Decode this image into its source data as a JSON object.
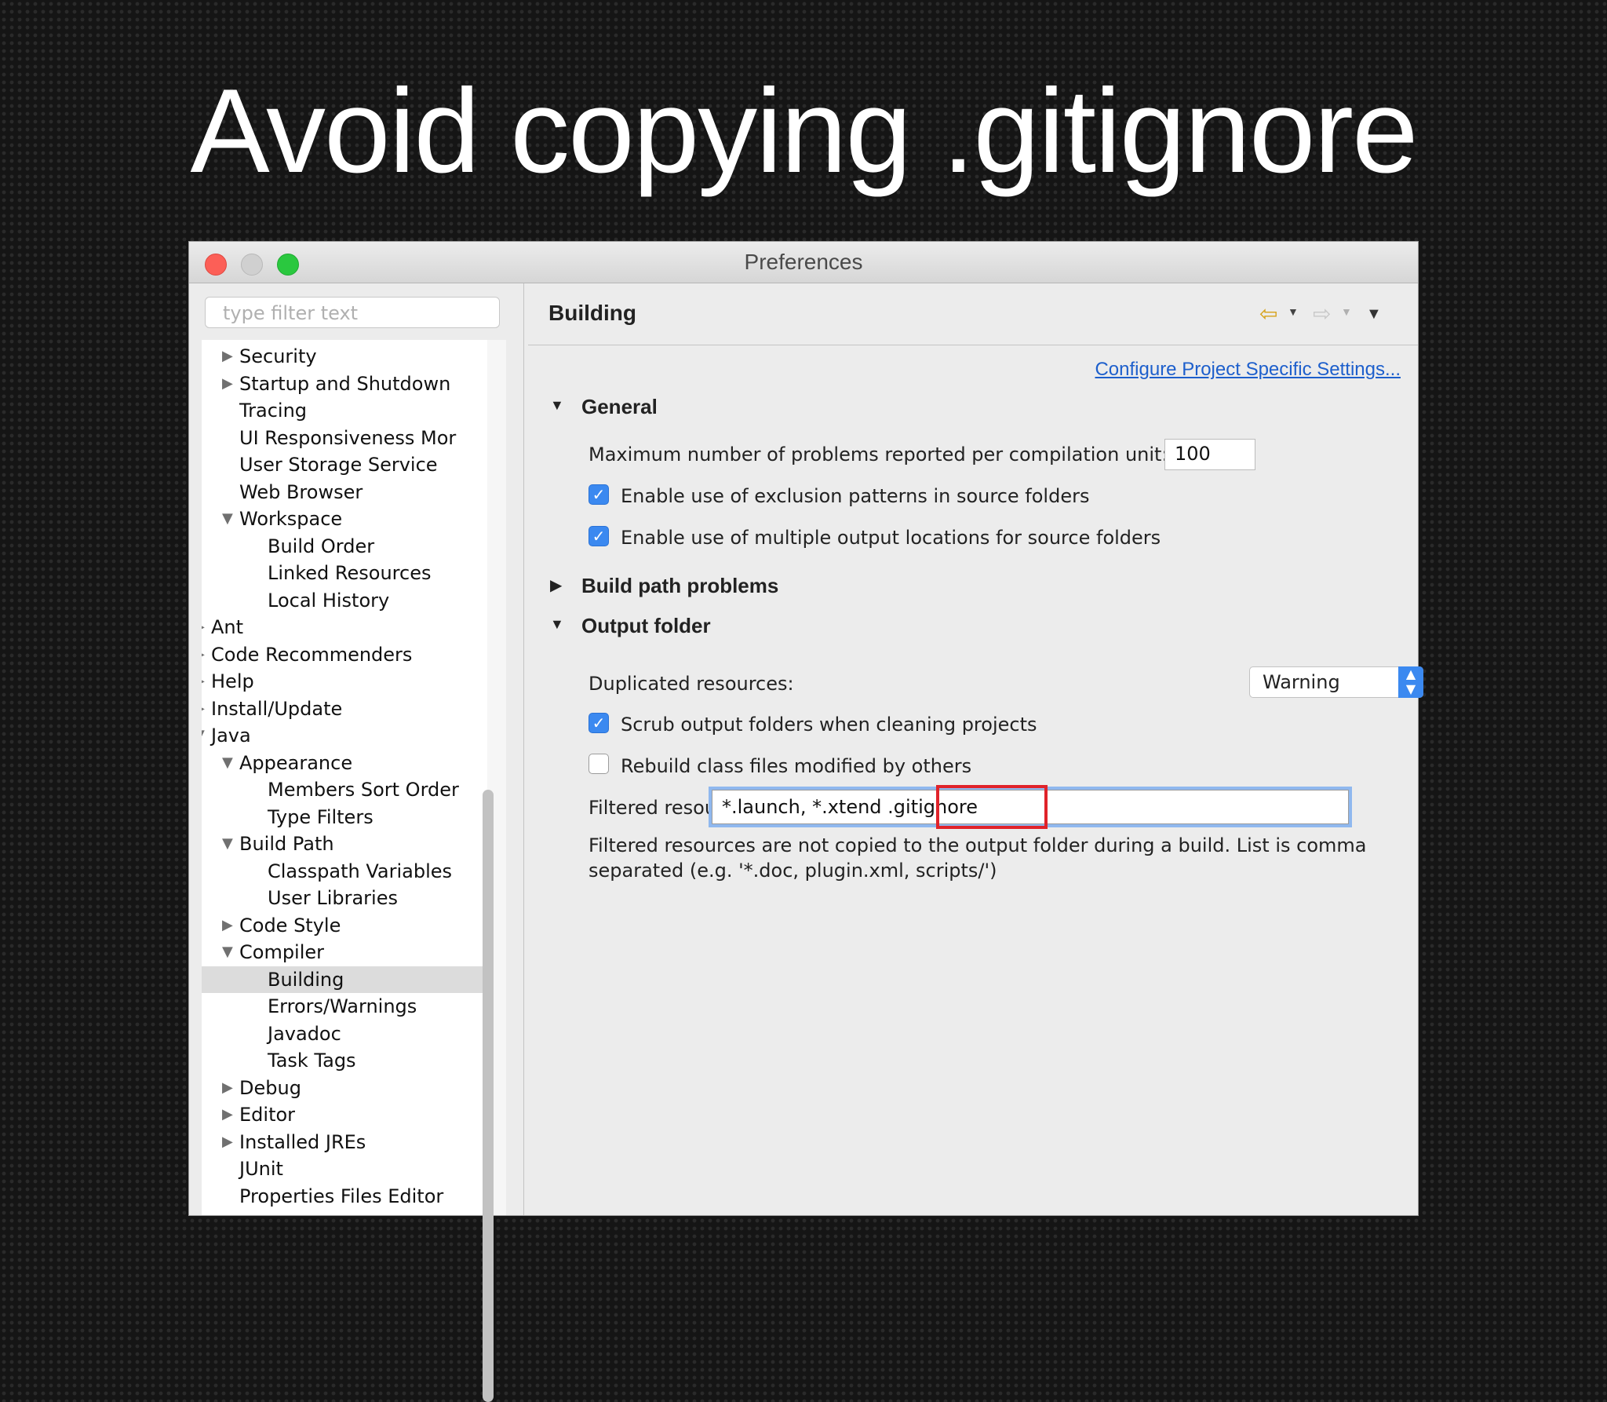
{
  "slide": {
    "title": "Avoid copying .gitignore"
  },
  "window": {
    "title": "Preferences"
  },
  "filter": {
    "placeholder": "type filter text"
  },
  "tree": [
    {
      "label": "Security",
      "level": 1,
      "toggle": "collapsed"
    },
    {
      "label": "Startup and Shutdown",
      "level": 1,
      "toggle": "collapsed"
    },
    {
      "label": "Tracing",
      "level": 1,
      "toggle": "none"
    },
    {
      "label": "UI Responsiveness Mor",
      "level": 1,
      "toggle": "none"
    },
    {
      "label": "User Storage Service",
      "level": 1,
      "toggle": "none"
    },
    {
      "label": "Web Browser",
      "level": 1,
      "toggle": "none"
    },
    {
      "label": "Workspace",
      "level": 1,
      "toggle": "expanded"
    },
    {
      "label": "Build Order",
      "level": 2,
      "toggle": "none"
    },
    {
      "label": "Linked Resources",
      "level": 2,
      "toggle": "none"
    },
    {
      "label": "Local History",
      "level": 2,
      "toggle": "none"
    },
    {
      "label": "Ant",
      "level": 0,
      "toggle": "collapsed"
    },
    {
      "label": "Code Recommenders",
      "level": 0,
      "toggle": "collapsed"
    },
    {
      "label": "Help",
      "level": 0,
      "toggle": "collapsed"
    },
    {
      "label": "Install/Update",
      "level": 0,
      "toggle": "collapsed"
    },
    {
      "label": "Java",
      "level": 0,
      "toggle": "expanded"
    },
    {
      "label": "Appearance",
      "level": 1,
      "toggle": "expanded"
    },
    {
      "label": "Members Sort Order",
      "level": 2,
      "toggle": "none"
    },
    {
      "label": "Type Filters",
      "level": 2,
      "toggle": "none"
    },
    {
      "label": "Build Path",
      "level": 1,
      "toggle": "expanded"
    },
    {
      "label": "Classpath Variables",
      "level": 2,
      "toggle": "none"
    },
    {
      "label": "User Libraries",
      "level": 2,
      "toggle": "none"
    },
    {
      "label": "Code Style",
      "level": 1,
      "toggle": "collapsed"
    },
    {
      "label": "Compiler",
      "level": 1,
      "toggle": "expanded"
    },
    {
      "label": "Building",
      "level": 2,
      "toggle": "none",
      "selected": true
    },
    {
      "label": "Errors/Warnings",
      "level": 2,
      "toggle": "none"
    },
    {
      "label": "Javadoc",
      "level": 2,
      "toggle": "none"
    },
    {
      "label": "Task Tags",
      "level": 2,
      "toggle": "none"
    },
    {
      "label": "Debug",
      "level": 1,
      "toggle": "collapsed"
    },
    {
      "label": "Editor",
      "level": 1,
      "toggle": "collapsed"
    },
    {
      "label": "Installed JREs",
      "level": 1,
      "toggle": "collapsed"
    },
    {
      "label": "JUnit",
      "level": 1,
      "toggle": "none"
    },
    {
      "label": "Properties Files Editor",
      "level": 1,
      "toggle": "none"
    }
  ],
  "page": {
    "title": "Building",
    "nav": {
      "back_icon": "back-arrow-icon",
      "forward_icon": "forward-arrow-icon",
      "menu_icon": "view-menu-icon"
    },
    "configure_link": "Configure Project Specific Settings...",
    "general": {
      "heading": "General",
      "max_problems_label": "Maximum number of problems reported per compilation unit:",
      "max_problems_value": "100",
      "exclusion_label": "Enable use of exclusion patterns in source folders",
      "exclusion_checked": true,
      "multiple_output_label": "Enable use of multiple output locations for source folders",
      "multiple_output_checked": true
    },
    "build_path_problems": {
      "heading": "Build path problems"
    },
    "output_folder": {
      "heading": "Output folder",
      "duplicated_label": "Duplicated resources:",
      "duplicated_value": "Warning",
      "scrub_label": "Scrub output folders when cleaning projects",
      "scrub_checked": true,
      "rebuild_label": "Rebuild class files modified by others",
      "rebuild_checked": false,
      "filtered_label": "Filtered resources:",
      "filtered_value": "*.launch, *.xtend .gitignore",
      "filtered_help_1": "Filtered resources are not copied to the output folder during a build. List is comma",
      "filtered_help_2": "separated (e.g. '*.doc, plugin.xml, scripts/')"
    }
  },
  "colors": {
    "accent": "#3b89f0",
    "highlight": "#e0232a",
    "link": "#1d5fcc"
  }
}
